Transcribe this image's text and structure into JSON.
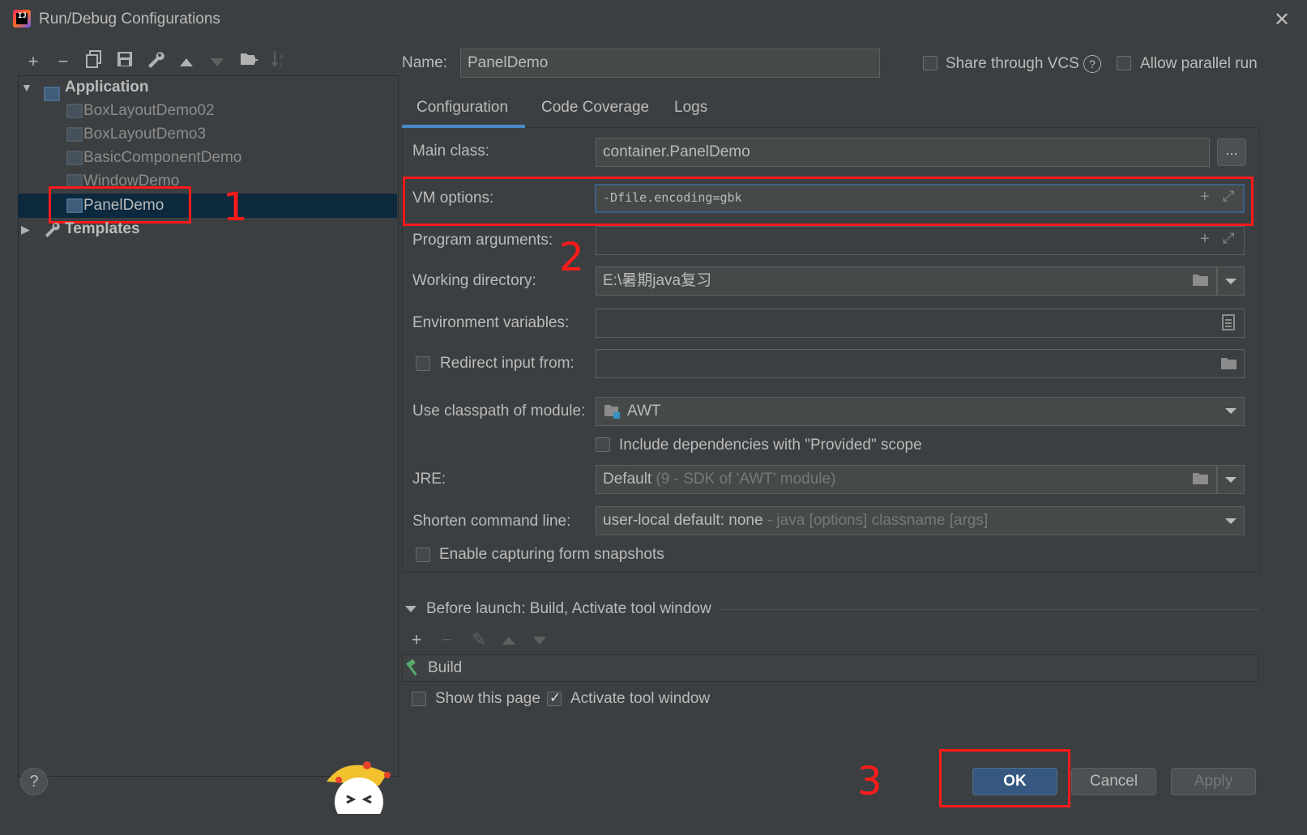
{
  "window": {
    "title": "Run/Debug Configurations",
    "close_glyph": "✕"
  },
  "toolbar": {
    "icons": [
      "add-icon",
      "remove-icon",
      "copy-icon",
      "save-icon",
      "wrench-icon",
      "move-up-icon",
      "move-down-icon",
      "folder-add-icon",
      "sort-icon"
    ]
  },
  "tree": {
    "application_label": "Application",
    "items": [
      "BoxLayoutDemo02",
      "BoxLayoutDemo3",
      "BasicComponentDemo",
      "WindowDemo",
      "PanelDemo"
    ],
    "templates_label": "Templates"
  },
  "annotations": {
    "one": "1",
    "two": "2",
    "three": "3"
  },
  "header": {
    "name_label": "Name:",
    "name_value": "PanelDemo",
    "share_label": "Share through VCS",
    "help_glyph": "?",
    "parallel_label": "Allow parallel run"
  },
  "tabs": [
    "Configuration",
    "Code Coverage",
    "Logs"
  ],
  "config": {
    "main_class_label": "Main class:",
    "main_class_value": "container.PanelDemo",
    "browse_label": "...",
    "vm_options_label": "VM options:",
    "vm_options_value": "-Dfile.encoding=gbk",
    "program_args_label": "Program arguments:",
    "working_dir_label": "Working directory:",
    "working_dir_value": "E:\\暑期java复习",
    "env_vars_label": "Environment variables:",
    "redirect_label": "Redirect input from:",
    "classpath_label": "Use classpath of module:",
    "classpath_value": "AWT",
    "include_deps_label": "Include dependencies with \"Provided\" scope",
    "jre_label": "JRE:",
    "jre_value": "Default",
    "jre_hint": "(9 - SDK of 'AWT' module)",
    "shorten_label": "Shorten command line:",
    "shorten_value": "user-local default: none",
    "shorten_hint": "- java [options] classname [args]",
    "snapshots_label": "Enable capturing form snapshots"
  },
  "before_launch": {
    "title": "Before launch: Build, Activate tool window",
    "task": "Build",
    "show_page_label": "Show this page",
    "activate_label": "Activate tool window"
  },
  "buttons": {
    "ok": "OK",
    "cancel": "Cancel",
    "apply": "Apply",
    "help": "?"
  },
  "colors": {
    "accent": "#4a88c7",
    "annotation_red": "#ff1a1a",
    "primary_button": "#365880",
    "selection": "#0d293e"
  }
}
